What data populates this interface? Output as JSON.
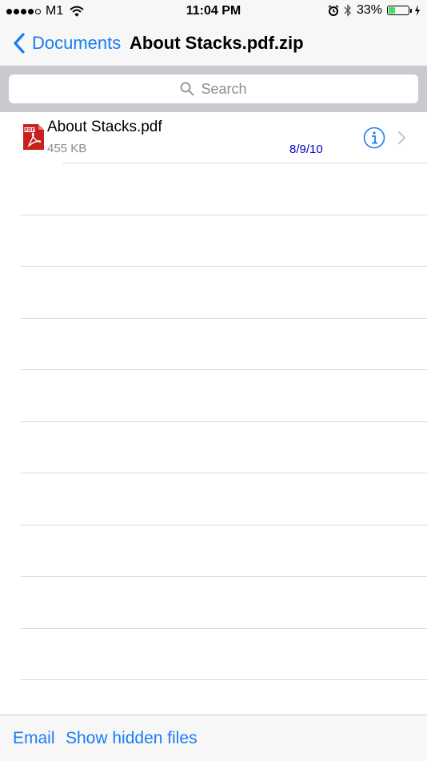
{
  "status_bar": {
    "carrier": "M1",
    "time": "11:04 PM",
    "battery_percent": "33%",
    "battery_level": 0.33,
    "icons": [
      "signal-dots-icon",
      "wifi-icon",
      "alarm-icon",
      "bluetooth-icon",
      "battery-icon",
      "charging-bolt-icon"
    ]
  },
  "nav": {
    "back_label": "Documents",
    "title": "About Stacks.pdf.zip"
  },
  "search": {
    "placeholder": "Search"
  },
  "files": [
    {
      "name": "About Stacks.pdf",
      "size": "455 KB",
      "date": "8/9/10",
      "icon": "pdf-file-icon"
    }
  ],
  "toolbar": {
    "email_label": "Email",
    "hidden_files_label": "Show hidden files"
  },
  "colors": {
    "accent": "#1a7cf3",
    "date_text": "#0000cc",
    "search_bg": "#c9c9ce",
    "battery_fill": "#4cd964"
  }
}
